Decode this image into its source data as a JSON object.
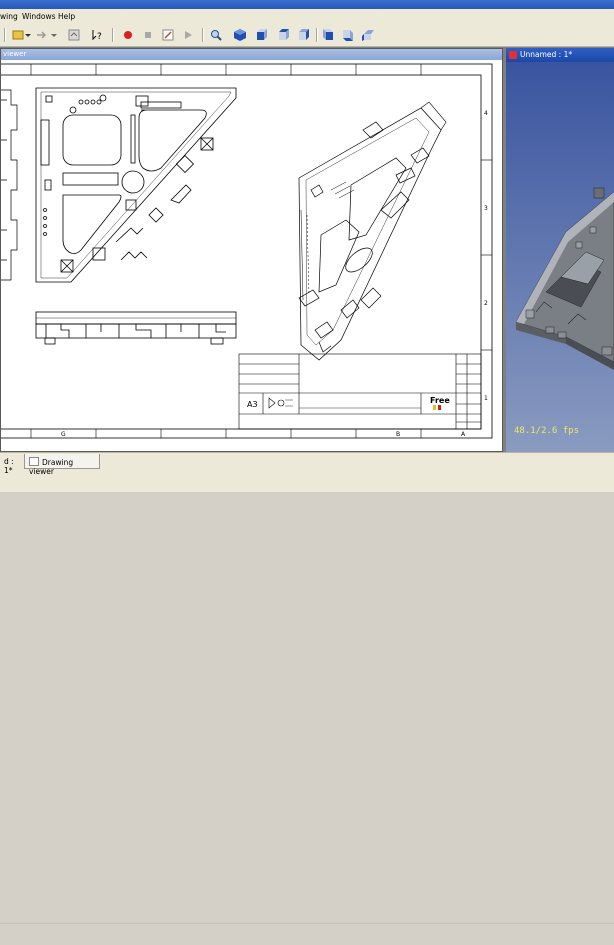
{
  "menu": {
    "items": [
      "wing",
      "Windows",
      "Help"
    ]
  },
  "toolbar": {
    "icons": [
      "macro-icon",
      "dropdown-icon",
      "arrow-icon",
      "dropdown-icon",
      "refresh-icon",
      "whats-this-icon",
      "record-icon",
      "stop-icon",
      "edit-macro-icon",
      "run-icon",
      "zoom-icon",
      "view-axo-icon",
      "view-front-icon",
      "view-top-icon",
      "view-right-icon",
      "view-rear-icon",
      "view-bottom-icon",
      "view-left-icon"
    ]
  },
  "drawing_window": {
    "title": "viewer",
    "titleblock": {
      "sheet_size": "A3",
      "brand": "Free"
    },
    "border": {
      "col_labels": [
        "G",
        "B",
        "A"
      ],
      "row_labels": [
        "4",
        "3",
        "2",
        "1"
      ]
    }
  },
  "view_window": {
    "title": "Unnamed : 1*",
    "fps": "48.1/2.6 fps"
  },
  "tabs": {
    "tab1": "d : 1*",
    "tab2": "Drawing viewer"
  },
  "colors": {
    "titlebar": "#2a58b8",
    "viewport": "#5a6ea0",
    "fps": "#f0e860",
    "model": "#8a8f96"
  }
}
